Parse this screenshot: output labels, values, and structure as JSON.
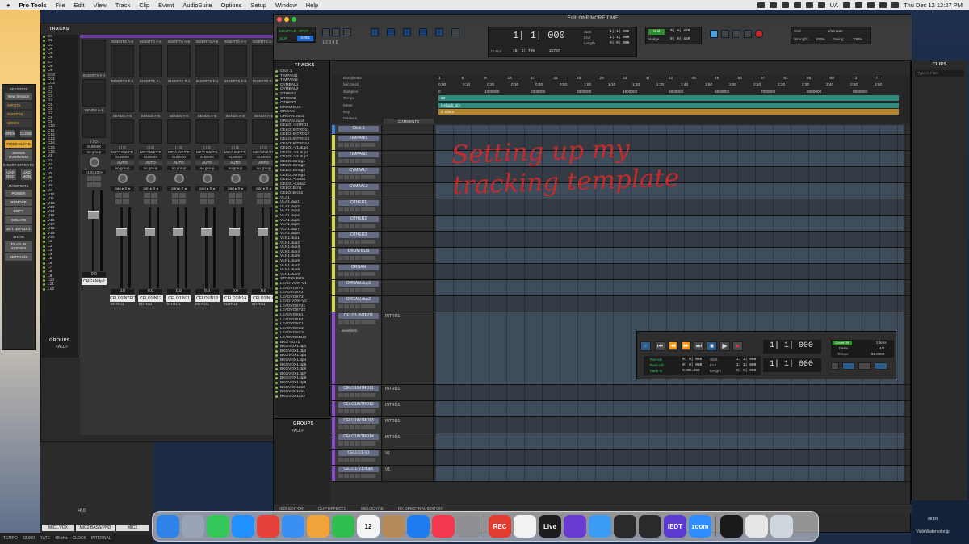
{
  "menubar": {
    "app": "Pro Tools",
    "items": [
      "File",
      "Edit",
      "View",
      "Track",
      "Clip",
      "Event",
      "AudioSuite",
      "Options",
      "Setup",
      "Window",
      "Help"
    ],
    "locale": "UA",
    "clock": "Thu Dec 12  12:27 PM"
  },
  "sidepanel": {
    "sessions_label": "SESSIONS",
    "new_session": "New Session",
    "inputs": "INPUTS",
    "inserts": "INSERTS",
    "sends": "SENDS",
    "open": "OPEN",
    "close": "CLOSE",
    "fixed_slots": "FIXED SLOTS",
    "sends_overview": "SENDS OVERVIEW",
    "insert_effects": "INSERT EFFECTS",
    "uad_rec": "UAD REC",
    "uad_mon": "UAD MON",
    "modifiers": "MODIFIERS",
    "power": "POWER",
    "remove": "REMOVE",
    "copy": "COPY",
    "isolate": "ISOLATE",
    "set_default": "SET DEFAULT",
    "show": "SHOW",
    "plugin_scenes": "PLUG-IN SCENES",
    "settings": "SETTINGS"
  },
  "mix": {
    "tracks_label": "TRACKS",
    "groups_label": "GROUPS",
    "groups_all": "<ALL>",
    "instrument_label": "INSTRUMENT",
    "track_list": [
      "O1",
      "O2",
      "O3",
      "O4",
      "O5",
      "O6",
      "O7",
      "O8",
      "O9",
      "O10",
      "O11",
      "O12",
      "C1",
      "C2",
      "C3",
      "C4",
      "C5",
      "C6",
      "C7",
      "C8",
      "C9",
      "C10",
      "C11",
      "C12",
      "C13",
      "C14",
      "C15",
      "C16",
      "V1",
      "V2",
      "V3",
      "V4",
      "V5",
      "V6",
      "V7",
      "V8",
      "V9",
      "V10",
      "V11",
      "V12",
      "V13",
      "V14",
      "V15",
      "V16",
      "V17",
      "V18",
      "V19",
      "V20",
      "L1",
      "L2",
      "L3",
      "L4",
      "L5",
      "L6",
      "L7",
      "L8",
      "L9",
      "L10",
      "L11",
      "L12"
    ],
    "strips": [
      {
        "name": "ORGANdp2",
        "comment": "",
        "inserts": "",
        "io": "",
        "auto": "",
        "pan": "<100  100>",
        "vol": "0.0"
      },
      {
        "name": "CELO1INTRO",
        "comment": "INTRO1",
        "inserts": "INSERTS A-E",
        "io": "MIC/LINE/CE",
        "auto": "AUTO",
        "pan": "pan ▸ 0 ◂",
        "vol": "0.0"
      },
      {
        "name": "CELO1IN12",
        "comment": "INTRO1",
        "inserts": "INSERTS A-E",
        "io": "MIC/LINE/CE",
        "auto": "AUTO",
        "pan": "pan ▸ 0 ◂",
        "vol": "0.0"
      },
      {
        "name": "CELO1IN11",
        "comment": "INTRO1",
        "inserts": "INSERTS A-E",
        "io": "MIC/LINE/CE",
        "auto": "AUTO",
        "pan": "pan ▸ 0 ◂",
        "vol": "0.0"
      },
      {
        "name": "CELO1IN13",
        "comment": "INTRO1",
        "inserts": "INSERTS A-E",
        "io": "MIC/LINE/CE",
        "auto": "AUTO",
        "pan": "pan ▸ 0 ◂",
        "vol": "0.0"
      },
      {
        "name": "CELO1IN14",
        "comment": "INTRO1",
        "inserts": "INSERTS A-E",
        "io": "MIC/LINE/CE",
        "auto": "AUTO",
        "pan": "pan ▸ 0 ◂",
        "vol": "0.0"
      },
      {
        "name": "CELO1IN16",
        "comment": "INTRO1",
        "inserts": "INSERTS A-E",
        "io": "MIC/LINE/CE",
        "auto": "AUTO",
        "pan": "pan ▸ 0 ◂",
        "vol": "0.0"
      }
    ],
    "inserts_fj": "INSERTS F-J",
    "sends_ae": "SENDS A-E",
    "io_label": "I / O",
    "no_input": "no input",
    "submix": "SUBMIX",
    "no_group": "no group",
    "dyn": "dyn"
  },
  "mixpeek": {
    "names": [
      "MIC1.VOX",
      "MIC2.BASS/PNO",
      "MIC3"
    ],
    "vol": "+6.0"
  },
  "statusbar": {
    "tempo_label": "TEMPO",
    "tempo": "92.000",
    "rate_label": "RATE",
    "rate": "48 kHz",
    "clock_label": "CLOCK",
    "clock": "INTERNAL"
  },
  "edit": {
    "title": "Edit: ONE MORE TIME",
    "mode_shuffle": "SHUFFLE",
    "mode_spot": "SPOT",
    "mode_slip": "SLIP",
    "mode_grid": "GRID",
    "main_counter": "1| 1| 000",
    "cursor_label": "Cursor",
    "cursor": "16| 2| 789",
    "start_label": "Start",
    "end_label": "End",
    "length_label": "Length",
    "start": "1| 1| 000",
    "end": "1| 1| 000",
    "length": "0| 0| 000",
    "sample_count": "32767",
    "grid_label": "Grid",
    "grid_value": "0| 0| 480",
    "nudge_label": "Nudge",
    "nudge_value": "0| 0| 480",
    "grid_note": "1/16 note",
    "strength_label": "Strength:",
    "strength": "100%",
    "swing_label": "Swing:",
    "swing": "100%",
    "tracks_label": "TRACKS",
    "groups_label": "GROUPS",
    "groups_all": "<ALL>",
    "tracklist": [
      "Click 1",
      "TIMPANI1",
      "TIMPANI2",
      "CYMBAL1",
      "CYMBAL2",
      "OTHER1",
      "OTHER2",
      "OTHER3",
      "DRUM BUS",
      "ORGAN",
      "ORGAN.dup1",
      "ORGAN.dup2",
      "CELO1-INTRO1",
      "CELO1INTRO11",
      "CELO1INTRO12",
      "CELO1INTRO13",
      "CELO1INTRO14",
      "CELO1-V1.dup1",
      "CELO1-V1.dup2",
      "CELO1-V1.dup3",
      "CELO1String1",
      "CELO1String2",
      "CELO1String3",
      "CELO1String4",
      "CELO1-Coda1",
      "CELO1-Coda2",
      "CELO1Bch1",
      "CELO1Brch2",
      "VLA1",
      "VLA1.dup1",
      "VLA1.dup2",
      "VLA1.dup3",
      "VLA1.dup4",
      "VLA1.dup5",
      "VLA1.dup6",
      "VLA1.dup7",
      "VLA1.dup8",
      "VLN1.dup1",
      "VLN1.dup2",
      "VLN1.dup3",
      "VLN1.dup4",
      "VLN1.dup5",
      "VLN1.dup6",
      "VLN1.dup7",
      "VLN1.dup8",
      "VLN1.dup9",
      "STRING BUS",
      "LEAD VOX -V1",
      "LEADVOXV1",
      "LEADVOXV2",
      "LEADVOXV3",
      "LEAD VOX -V2",
      "LEADVOXV21",
      "LEADVOXV22",
      "LEADVOXB1",
      "LEADVOXB2",
      "LEADVOXC1",
      "LEADVOXC2",
      "LEADVOXC3",
      "LEADVOXBUS",
      "BKG VOX1",
      "BKGVOX1.dp1",
      "BKGVOX1.dp2",
      "BKGVOX1.dp3",
      "BKGVOX1.dp4",
      "BKGVOX1.dp5",
      "BKGVOX1.dp6",
      "BKGVOX1.dp7",
      "BKGVOX1.dp8",
      "BKGVOX1.dp9",
      "BKGVOX1d10",
      "BKGVOX1d11",
      "BKGVOX1d12"
    ],
    "ruler_labels": [
      "Bars|Beats",
      "Min:Secs",
      "Samples",
      "Tempo",
      "Meter",
      "Key",
      "Markers"
    ],
    "bars": [
      "1",
      "5",
      "9",
      "13",
      "17",
      "21",
      "25",
      "29",
      "33",
      "37",
      "41",
      "45",
      "49",
      "53",
      "57",
      "61",
      "65",
      "69",
      "73",
      "77"
    ],
    "minsecs": [
      "0:00",
      "0:10",
      "0:20",
      "0:30",
      "0:40",
      "0:50",
      "1:00",
      "1:10",
      "1:20",
      "1:30",
      "1:40",
      "1:50",
      "2:00",
      "2:10",
      "2:20",
      "2:30",
      "2:40",
      "2:50",
      "3:00"
    ],
    "samples": [
      "0",
      "1000000",
      "2000000",
      "3000000",
      "4000000",
      "5000000",
      "6000000",
      "7000000",
      "8000000",
      "9000000"
    ],
    "tempo_marker": "92",
    "meter_marker": "Default: 4/4",
    "key_marker": "C minor",
    "comments_label": "COMMENTS",
    "lanes": [
      {
        "name": "Click 1",
        "comment": "",
        "color": "#3a7fd0",
        "h": 12,
        "dark": false
      },
      {
        "name": "TIMPANI1",
        "comment": "",
        "color": "#d8d850",
        "h": 20,
        "dark": true
      },
      {
        "name": "TIMPANI2",
        "comment": "",
        "color": "#d8d850",
        "h": 20,
        "dark": false
      },
      {
        "name": "CYMBAL1",
        "comment": "",
        "color": "#d8d850",
        "h": 20,
        "dark": true
      },
      {
        "name": "CYMBAL2",
        "comment": "",
        "color": "#d8d850",
        "h": 20,
        "dark": false
      },
      {
        "name": "OTHER1",
        "comment": "",
        "color": "#d8d850",
        "h": 20,
        "dark": true
      },
      {
        "name": "OTHER2",
        "comment": "",
        "color": "#d8d850",
        "h": 20,
        "dark": false
      },
      {
        "name": "OTHER3",
        "comment": "",
        "color": "#d8d850",
        "h": 20,
        "dark": true
      },
      {
        "name": "DRUM BUS",
        "comment": "",
        "color": "#d8d850",
        "h": 20,
        "dark": false
      },
      {
        "name": "ORGAN",
        "comment": "",
        "color": "#d8d850",
        "h": 20,
        "dark": true
      },
      {
        "name": "ORGAN.dup1",
        "comment": "",
        "color": "#d8d850",
        "h": 20,
        "dark": false
      },
      {
        "name": "ORGAN.dup2",
        "comment": "",
        "color": "#d8d850",
        "h": 20,
        "dark": true
      },
      {
        "name": "CELO1-INTRO1",
        "comment": "INTRO1",
        "color": "#8a4ad0",
        "h": 90,
        "dark": false
      },
      {
        "name": "CELO1INTRO11",
        "comment": "INTRO1",
        "color": "#8a4ad0",
        "h": 20,
        "dark": true
      },
      {
        "name": "CELO1INTRO12",
        "comment": "INTRO1",
        "color": "#8a4ad0",
        "h": 20,
        "dark": false
      },
      {
        "name": "CELO1INTRO13",
        "comment": "INTRO1",
        "color": "#8a4ad0",
        "h": 20,
        "dark": true
      },
      {
        "name": "CELO1INTRO14",
        "comment": "INTRO1",
        "color": "#8a4ad0",
        "h": 20,
        "dark": false
      },
      {
        "name": "CELLO1-V1",
        "comment": "V1",
        "color": "#8a4ad0",
        "h": 20,
        "dark": true
      },
      {
        "name": "CELO1-V1.dup1",
        "comment": "V1",
        "color": "#8a4ad0",
        "h": 20,
        "dark": false
      }
    ],
    "insert_slots": "INSERTS",
    "waveform": "waveform",
    "bottom_tabs": [
      "MIDI EDITOR",
      "CLIP EFFECTS",
      "MELODYNE",
      "RX SPECTRAL EDITOR"
    ]
  },
  "handwriting": {
    "line1": "Setting up my",
    "line2": "tracking template"
  },
  "transport": {
    "counter1": "1| 1| 000",
    "counter2": "1| 1| 000",
    "preroll_label": "Pre-roll",
    "postroll_label": "Post-roll",
    "fadein_label": "Fade-in",
    "preroll": "0| 0| 000",
    "postroll": "0| 0| 000",
    "fadein": "0:00.250",
    "start_label": "Start",
    "end_label": "End",
    "length_label": "Length",
    "start": "1| 1| 000",
    "end": "1| 1| 000",
    "length": "0| 0| 000",
    "count_off": "Count Off",
    "meter_label": "Meter",
    "tempo_label": "Tempo",
    "bars": "2 bars",
    "meter": "4/4",
    "tempo": "92.0000"
  },
  "clips": {
    "label": "CLIPS",
    "filter": "Type to Filter"
  },
  "dock": {
    "apps": [
      {
        "name": "finder",
        "label": "",
        "color": "#2f82e8"
      },
      {
        "name": "launchpad",
        "label": "",
        "color": "#9aa3b8"
      },
      {
        "name": "messages",
        "label": "",
        "color": "#35c759"
      },
      {
        "name": "safari",
        "label": "",
        "color": "#1e90ff"
      },
      {
        "name": "chrome",
        "label": "",
        "color": "#e5433a"
      },
      {
        "name": "mail",
        "label": "",
        "color": "#3a8ff5"
      },
      {
        "name": "photos",
        "label": "",
        "color": "#f2a33a"
      },
      {
        "name": "facetime",
        "label": "",
        "color": "#2fbf4f"
      },
      {
        "name": "calendar",
        "label": "12",
        "color": "#f4f4f4"
      },
      {
        "name": "notes",
        "label": "",
        "color": "#b58a5a"
      },
      {
        "name": "appstore",
        "label": "",
        "color": "#1e7cf2"
      },
      {
        "name": "music",
        "label": "",
        "color": "#f2394f"
      },
      {
        "name": "system-settings",
        "label": "",
        "color": "#8e8e93"
      },
      {
        "name": "rec",
        "label": "REC",
        "color": "#e23b30"
      },
      {
        "name": "freeform",
        "label": "",
        "color": "#f2f2f2"
      },
      {
        "name": "live",
        "label": "Live",
        "color": "#1d1d1d"
      },
      {
        "name": "pro-tools",
        "label": "",
        "color": "#6b3ad0"
      },
      {
        "name": "weather",
        "label": "",
        "color": "#3a9cf2"
      },
      {
        "name": "uad-console",
        "label": "",
        "color": "#2a2a2a"
      },
      {
        "name": "uad-connect",
        "label": "",
        "color": "#2a2a2a"
      },
      {
        "name": "ilok",
        "label": "IEDT",
        "color": "#5a3ad0"
      },
      {
        "name": "zoom",
        "label": "zoom",
        "color": "#2d8cff"
      },
      {
        "name": "terminal",
        "label": "",
        "color": "#1a1a1a"
      },
      {
        "name": "preview",
        "label": "",
        "color": "#e6e6e6"
      },
      {
        "name": "trash",
        "label": "",
        "color": "#d0d6de"
      }
    ],
    "calendar_month": "DEC"
  },
  "desktop": {
    "file1": "de.txt",
    "file2": "ViolinWatercolor.jp"
  }
}
